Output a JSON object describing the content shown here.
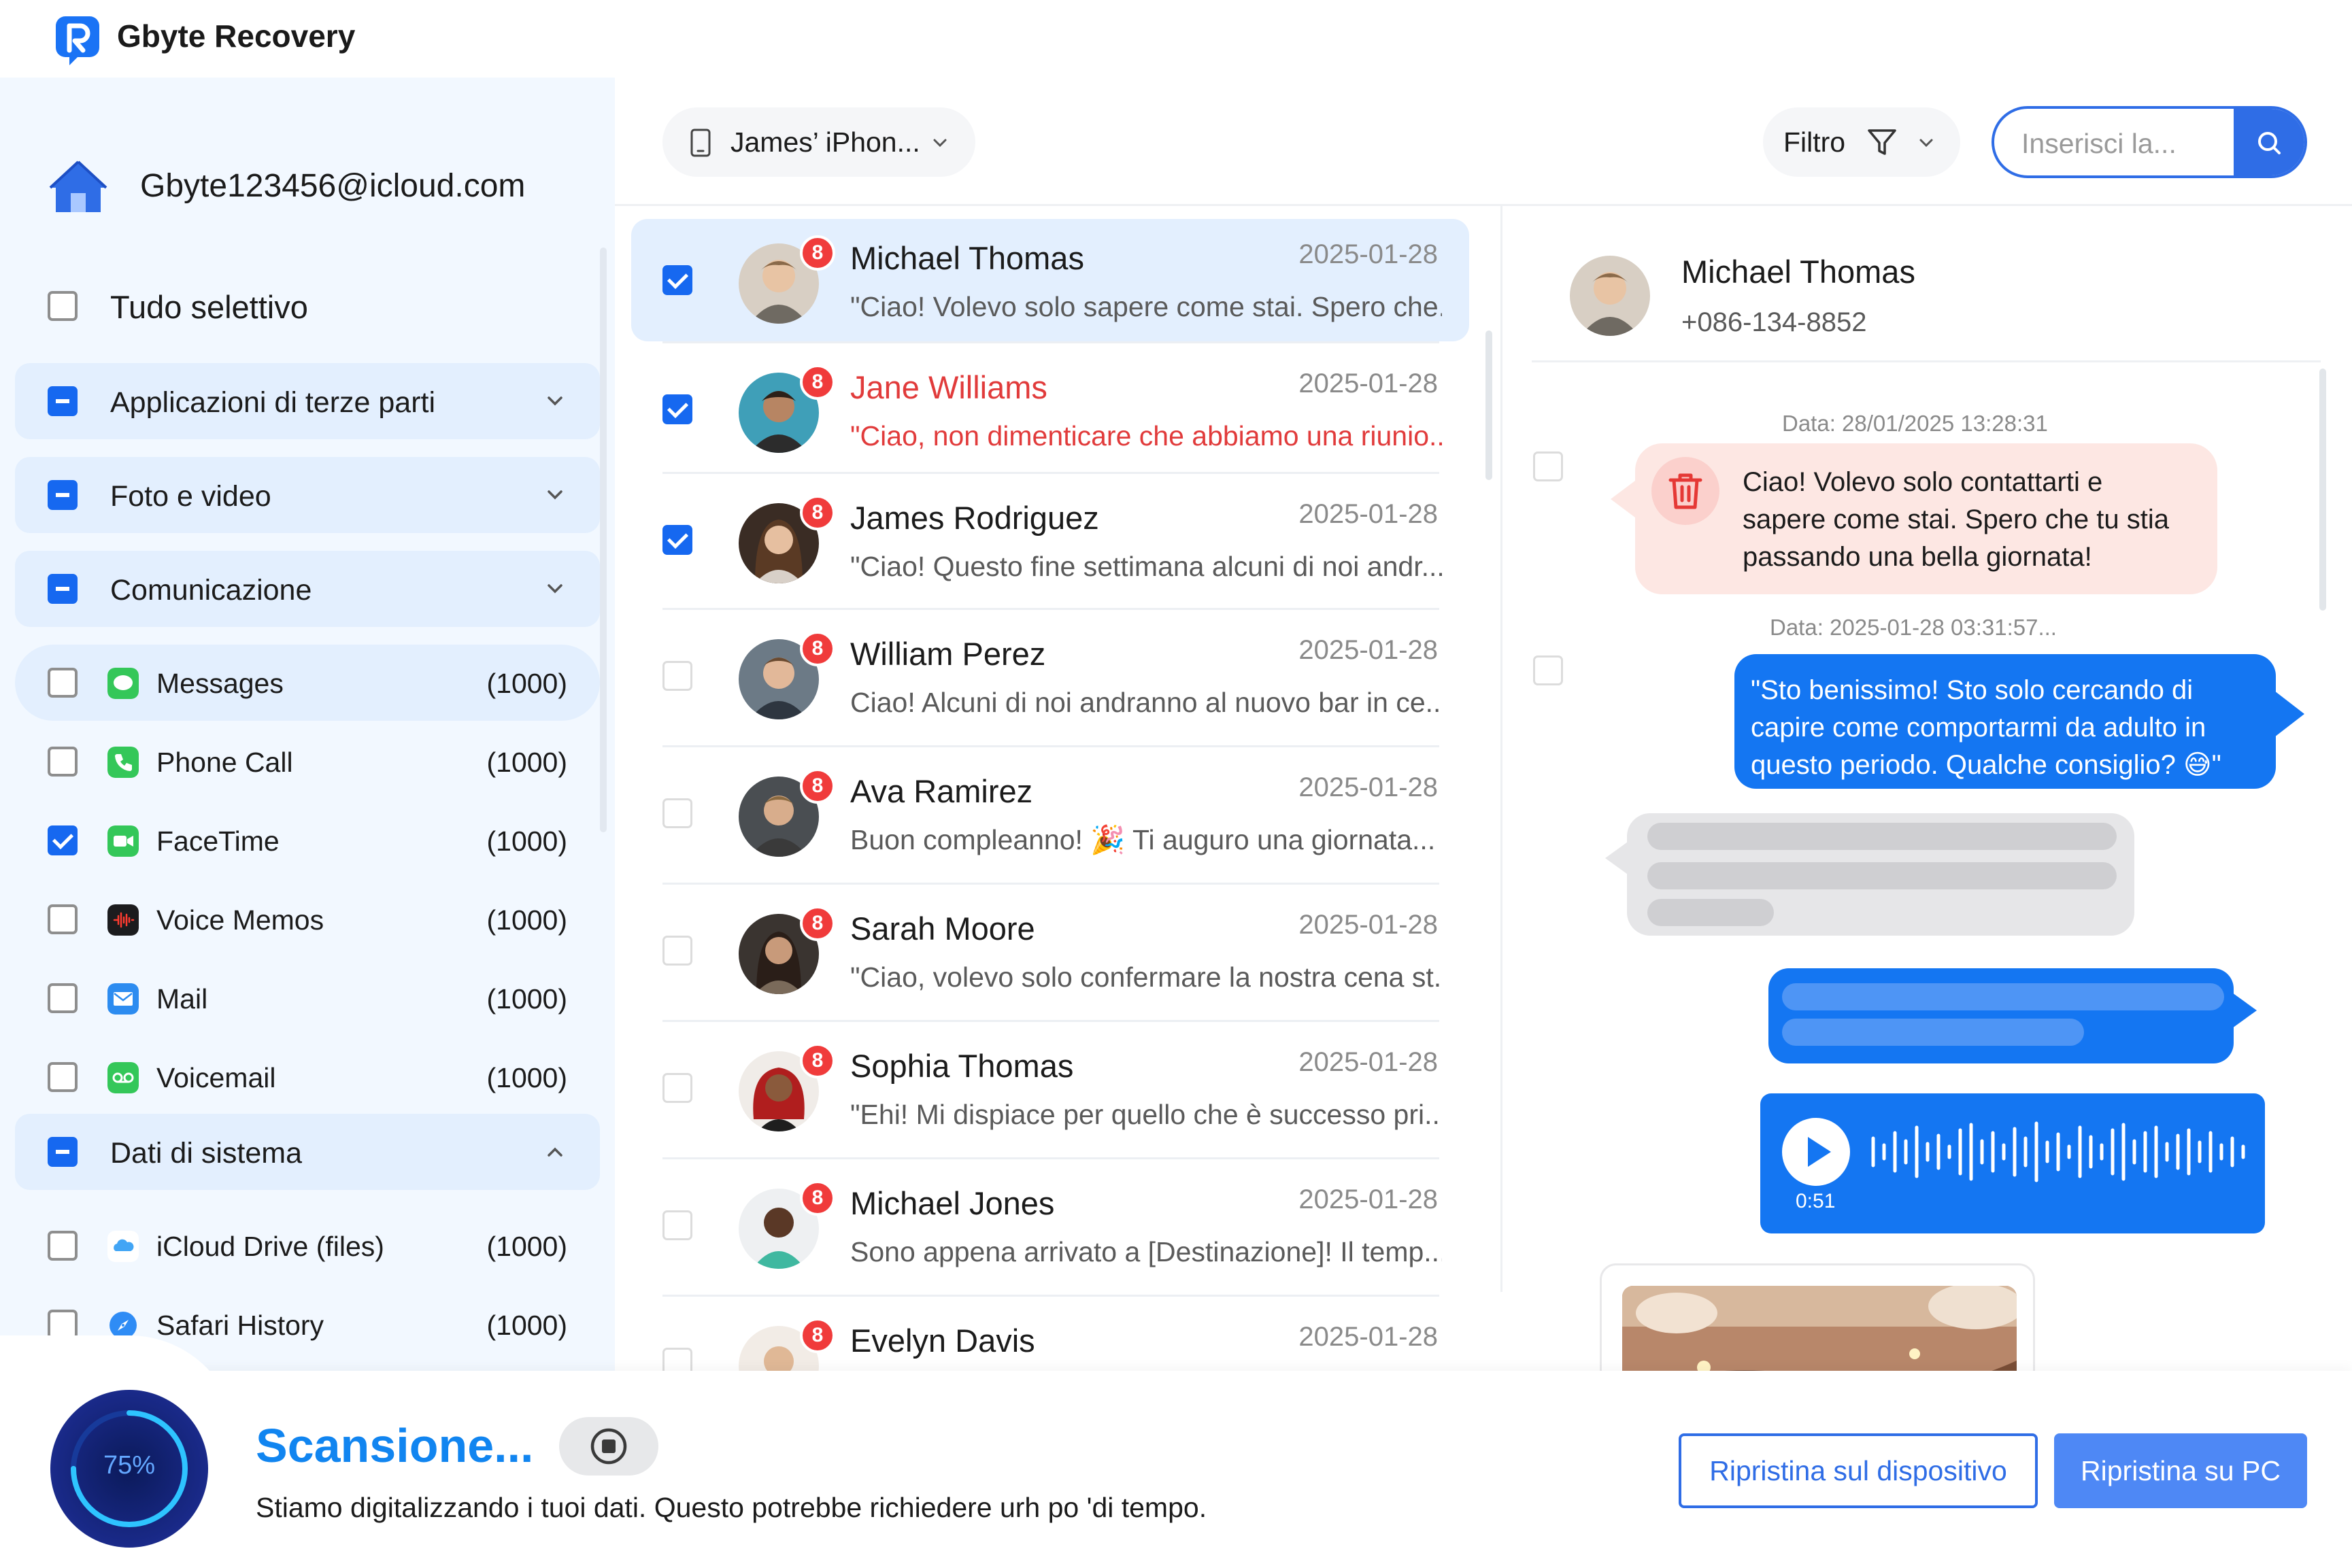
{
  "app": {
    "title": "Gbyte Recovery",
    "logo_icon": "gbyte-logo-icon"
  },
  "sidebar": {
    "account": "Gbyte123456@icloud.com",
    "select_all": {
      "label": "Tudo selettivo",
      "checked": false
    },
    "categories": [
      {
        "label": "Applicazioni di terze parti",
        "state": "partial",
        "expanded": false
      },
      {
        "label": "Foto e video",
        "state": "partial",
        "expanded": false
      },
      {
        "label": "Comunicazione",
        "state": "partial",
        "expanded": true
      },
      {
        "label": "Dati di sistema",
        "state": "partial",
        "expanded": true
      }
    ],
    "communication_items": [
      {
        "label": "Messages",
        "count": "(1000)",
        "checked": false,
        "icon": "messages-icon"
      },
      {
        "label": "Phone Call",
        "count": "(1000)",
        "checked": false,
        "icon": "phone-icon"
      },
      {
        "label": "FaceTime",
        "count": "(1000)",
        "checked": true,
        "icon": "facetime-icon"
      },
      {
        "label": "Voice Memos",
        "count": "(1000)",
        "checked": false,
        "icon": "voice-memos-icon"
      },
      {
        "label": "Mail",
        "count": "(1000)",
        "checked": false,
        "icon": "mail-icon"
      },
      {
        "label": "Voicemail",
        "count": "(1000)",
        "checked": false,
        "icon": "voicemail-icon"
      }
    ],
    "system_items": [
      {
        "label": "iCloud Drive (files)",
        "count": "(1000)",
        "checked": false,
        "icon": "icloud-icon"
      },
      {
        "label": "Safari History",
        "count": "(1000)",
        "checked": false,
        "icon": "safari-icon"
      }
    ]
  },
  "toolbar": {
    "device": "James’ iPhon...",
    "filter_label": "Filtro",
    "search_placeholder": "Inserisci la..."
  },
  "conversations": [
    {
      "name": "Michael Thomas",
      "date": "2025-01-28",
      "preview": "\"Ciao! Volevo solo sapere come stai. Spero che...",
      "badge": "8",
      "checked": true,
      "selected": true,
      "alert": false
    },
    {
      "name": "Jane Williams",
      "date": "2025-01-28",
      "preview": "\"Ciao, non dimenticare che abbiamo una riunio...",
      "badge": "8",
      "checked": true,
      "selected": false,
      "alert": true
    },
    {
      "name": "James Rodriguez",
      "date": "2025-01-28",
      "preview": "\"Ciao! Questo fine settimana alcuni di noi andr...",
      "badge": "8",
      "checked": true,
      "selected": false,
      "alert": false
    },
    {
      "name": "William Perez",
      "date": "2025-01-28",
      "preview": "Ciao! Alcuni di noi andranno al nuovo bar in ce...",
      "badge": "8",
      "checked": false,
      "selected": false,
      "alert": false
    },
    {
      "name": "Ava Ramirez",
      "date": "2025-01-28",
      "preview": "Buon compleanno! 🎉 Ti auguro una giornata...",
      "badge": "8",
      "checked": false,
      "selected": false,
      "alert": false
    },
    {
      "name": "Sarah Moore",
      "date": "2025-01-28",
      "preview": "\"Ciao, volevo solo confermare la nostra cena st...",
      "badge": "8",
      "checked": false,
      "selected": false,
      "alert": false
    },
    {
      "name": "Sophia Thomas",
      "date": "2025-01-28",
      "preview": "\"Ehi! Mi dispiace per quello che è successo pri...",
      "badge": "8",
      "checked": false,
      "selected": false,
      "alert": false
    },
    {
      "name": "Michael Jones",
      "date": "2025-01-28",
      "preview": "Sono appena arrivato a [Destinazione]! Il temp...",
      "badge": "8",
      "checked": false,
      "selected": false,
      "alert": false
    },
    {
      "name": "Evelyn Davis",
      "date": "2025-01-28",
      "preview": "",
      "badge": "8",
      "checked": false,
      "selected": false,
      "alert": false
    }
  ],
  "chat": {
    "contact_name": "Michael Thomas",
    "contact_phone": "+086-134-8852",
    "messages": [
      {
        "date": "Data: 28/01/2025 13:28:31",
        "text": "Ciao! Volevo solo contattarti e sapere come stai. Spero che tu stia passando una bella giornata!",
        "direction": "incoming",
        "deleted": true
      },
      {
        "date": "Data: 2025-01-28 03:31:57...",
        "text": "\"Sto benissimo! Sto solo cercando di capire come comportarmi da adulto in questo periodo. Qualche consiglio? 😅\"",
        "direction": "outgoing",
        "deleted": false
      }
    ],
    "voice_duration": "0:51"
  },
  "scan": {
    "progress_text": "75%",
    "progress": 0.75,
    "title": "Scansione...",
    "subtitle": "Stiamo digitalizzando i tuoi dati. Questo potrebbe richiedere urh po 'di tempo."
  },
  "actions": {
    "restore_device": "Ripristina sul dispositivo",
    "restore_pc": "Ripristina su PC"
  },
  "colors": {
    "accent": "#2f6de6",
    "bubble_blue": "#1476f2",
    "badge_red": "#f03b3b",
    "alert_red": "#e13b3b",
    "sidebar_bg": "#f2f8ff",
    "highlight_bg": "#e3effe",
    "scan_title": "#1185f0"
  }
}
